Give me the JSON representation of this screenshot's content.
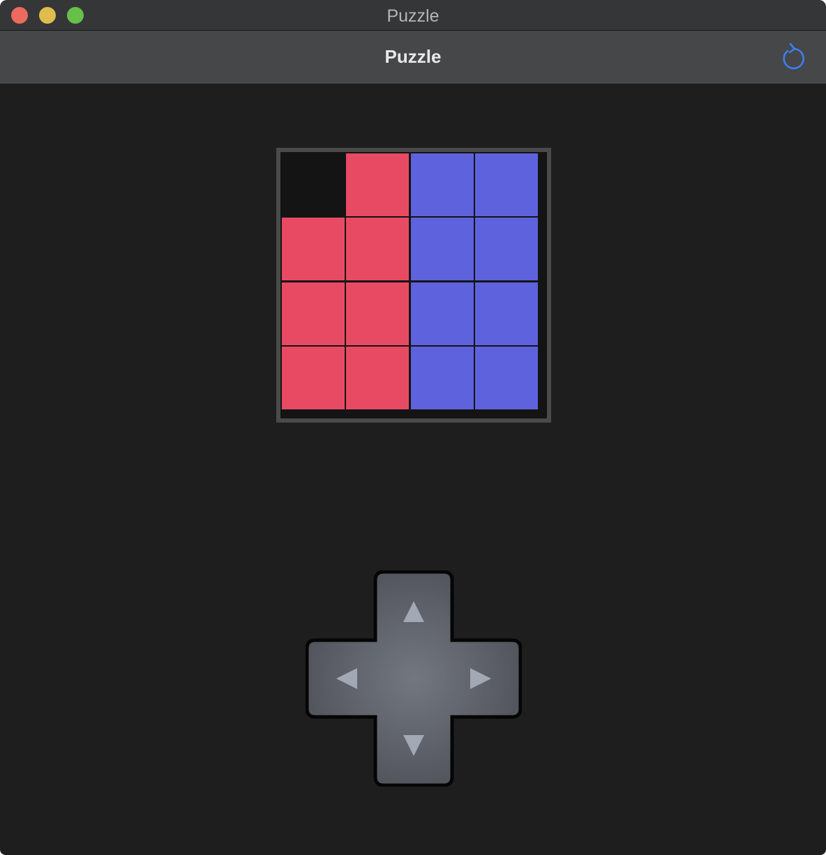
{
  "window": {
    "title": "Puzzle"
  },
  "navbar": {
    "title": "Puzzle",
    "refresh_icon": "refresh-icon"
  },
  "colors": {
    "red": "#e94a63",
    "blue": "#5f62dd",
    "empty": "#141414",
    "accent": "#3b7ff0"
  },
  "board": {
    "rows": 4,
    "cols": 4,
    "cells": [
      [
        "empty",
        "red",
        "blue",
        "blue"
      ],
      [
        "red",
        "red",
        "blue",
        "blue"
      ],
      [
        "red",
        "red",
        "blue",
        "blue"
      ],
      [
        "red",
        "red",
        "blue",
        "blue"
      ]
    ]
  },
  "dpad": {
    "up_icon": "arrow-up-icon",
    "down_icon": "arrow-down-icon",
    "left_icon": "arrow-left-icon",
    "right_icon": "arrow-right-icon"
  }
}
